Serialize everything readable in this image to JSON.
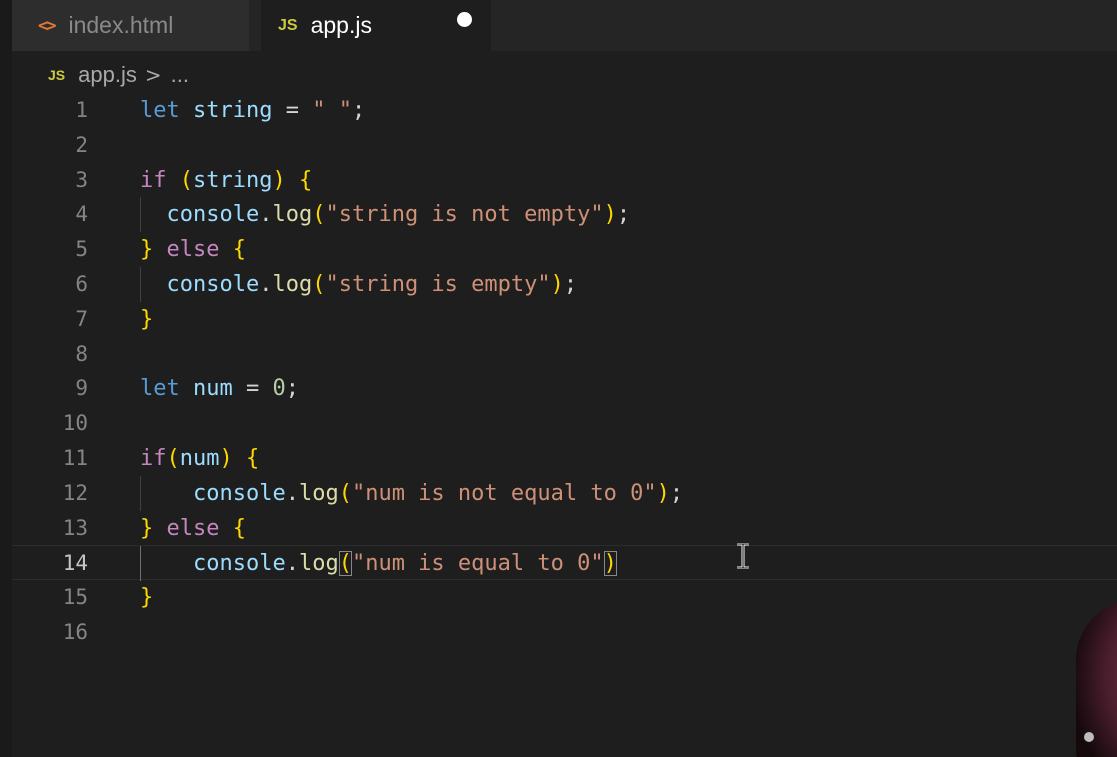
{
  "tabs": [
    {
      "icon": "html-icon",
      "icon_text": "<>",
      "label": "index.html",
      "active": false
    },
    {
      "icon": "js-icon",
      "icon_text": "JS",
      "label": "app.js",
      "active": true,
      "unsaved": true
    }
  ],
  "breadcrumb": {
    "icon_text": "JS",
    "file": "app.js",
    "separator": ">",
    "more": "..."
  },
  "editor": {
    "language": "javascript",
    "active_line": 14,
    "line_numbers": [
      "1",
      "2",
      "3",
      "4",
      "5",
      "6",
      "7",
      "8",
      "9",
      "10",
      "11",
      "12",
      "13",
      "14",
      "15",
      "16"
    ],
    "lines": [
      "let string = \" \";",
      "",
      "if (string) {",
      "  console.log(\"string is not empty\");",
      "} else {",
      "  console.log(\"string is empty\");",
      "}",
      "",
      "let num = 0;",
      "",
      "if(num) {",
      "    console.log(\"num is not equal to 0\");",
      "} else {",
      "    console.log(\"num is equal to 0\")",
      "}",
      ""
    ]
  },
  "colors": {
    "background": "#1e1e1e",
    "tab_bar": "#252526",
    "keyword_let": "#569cd6",
    "keyword_control": "#c586c0",
    "variable": "#9cdcfe",
    "function": "#dcdcaa",
    "string": "#ce9178",
    "number": "#b5cea8",
    "bracket_level1": "#ffd700",
    "bracket_level2": "#da70d6",
    "js_icon": "#cbcb41",
    "html_icon": "#e37933"
  }
}
